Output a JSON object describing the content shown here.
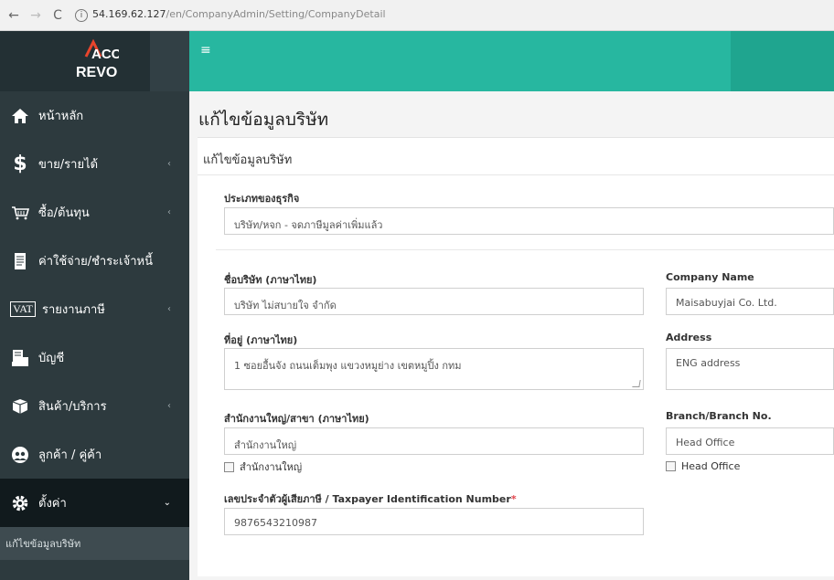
{
  "browser": {
    "back": "←",
    "forward": "→",
    "reload": "C",
    "info": "i",
    "url_host": "54.169.62.127",
    "url_path": "/en/CompanyAdmin/Setting/CompanyDetail"
  },
  "brand": {
    "logo_top": "ACC",
    "logo_bottom": "REVO",
    "accent": "#27b7a0",
    "sidebar_bg": "#2d3a3e"
  },
  "topbar": {
    "menu_glyph": "≡"
  },
  "sidebar": {
    "items": [
      {
        "label": "หน้าหลัก",
        "icon": "home-icon",
        "chevron": ""
      },
      {
        "label": "ขาย/รายได้",
        "icon": "dollar-icon",
        "chevron": "‹"
      },
      {
        "label": "ซื้อ/ต้นทุน",
        "icon": "cart-icon",
        "chevron": "‹"
      },
      {
        "label": "ค่าใช้จ่าย/ชำระเจ้าหนี้",
        "icon": "receipt-icon",
        "chevron": ""
      },
      {
        "label": "รายงานภาษี",
        "icon": "vat-icon",
        "chevron": "‹",
        "badge": "VAT"
      },
      {
        "label": "บัญชี",
        "icon": "accounting-icon",
        "chevron": ""
      },
      {
        "label": "สินค้า/บริการ",
        "icon": "product-icon",
        "chevron": "‹"
      },
      {
        "label": "ลูกค้า / คู่ค้า",
        "icon": "contacts-icon",
        "chevron": ""
      },
      {
        "label": "ตั้งค่า",
        "icon": "gear-icon",
        "chevron": "⌄"
      }
    ],
    "sub_active": "แก้ไขข้อมูลบริษัท"
  },
  "main": {
    "page_title": "แก้ไขข้อมูลบริษัท",
    "card_title": "แก้ไขข้อมูลบริษัท",
    "business_type_label": "ประเภทของธุรกิจ",
    "business_type_value": "บริษัท/หจก - จดภาษีมูลค่าเพิ่มแล้ว",
    "company_th_label": "ชื่อบริษัท (ภาษาไทย)",
    "company_th_value": "บริษัท ไม่สบายใจ จำกัด",
    "company_en_label": "Company Name",
    "company_en_value": "Maisabuyjai Co. Ltd.",
    "address_th_label": "ที่อยู่ (ภาษาไทย)",
    "address_th_value": "1 ซอยอื้นจัง ถนนเต็มพุง แขวงหมูย่าง เขตหมูปิ้ง กทม",
    "address_en_label": "Address",
    "address_en_value": "ENG address",
    "branch_th_label": "สำนักงานใหญ่/สาขา (ภาษาไทย)",
    "branch_th_value": "สำนักงานใหญ่",
    "branch_en_label": "Branch/Branch No.",
    "branch_en_value": "Head Office",
    "hq_check_th": "สำนักงานใหญ่",
    "hq_check_en": "Head Office",
    "tax_label": "เลขประจำตัวผู้เสียภาษี / Taxpayer Identification Number",
    "tax_required": "*",
    "tax_value": "9876543210987"
  }
}
